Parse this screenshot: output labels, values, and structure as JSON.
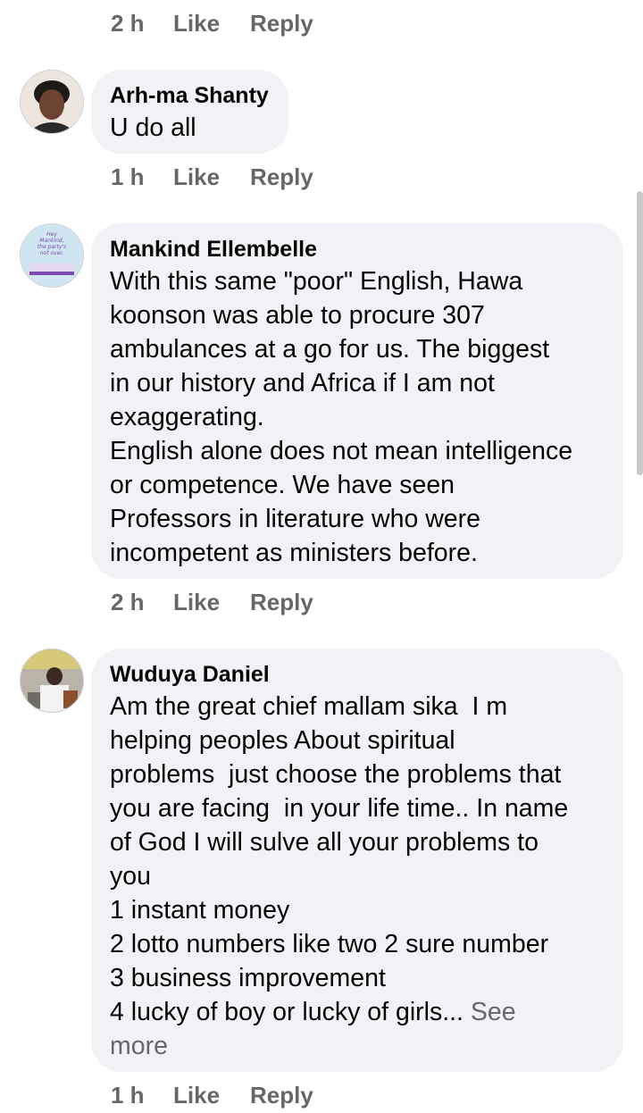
{
  "actions_labels": {
    "like": "Like",
    "reply": "Reply"
  },
  "top_actions": {
    "time": "2 h"
  },
  "comments": [
    {
      "author": "Arh-ma Shanty",
      "lines": [
        "U do all"
      ],
      "time": "1 h"
    },
    {
      "author": "Mankind Ellembelle",
      "avatar_text": [
        "Hey",
        "Mankind,",
        "the party's",
        "not over."
      ],
      "lines": [
        "With this same \"poor\" English, Hawa",
        "koonson was able to procure 307",
        "ambulances at a go for us. The biggest",
        "in our history and Africa if I am not",
        "exaggerating.",
        "English alone does not mean intelligence",
        "or competence. We have seen",
        "Professors in literature who were",
        "incompetent as ministers before."
      ],
      "time": "2 h"
    },
    {
      "author": "Wuduya Daniel",
      "lines": [
        "Am the great chief mallam sika  I m",
        "helping peoples About spiritual",
        "problems  just choose the problems that",
        "you are facing  in your life time.. In name",
        "of God I will sulve all your problems to",
        "you",
        "1 instant money",
        "2 lotto numbers like two 2 sure number",
        "3 business improvement",
        "4 lucky of boy or lucky of girls..."
      ],
      "see_more": "See more",
      "see_more_first": "See",
      "see_more_second": "more",
      "time": "1 h"
    }
  ]
}
